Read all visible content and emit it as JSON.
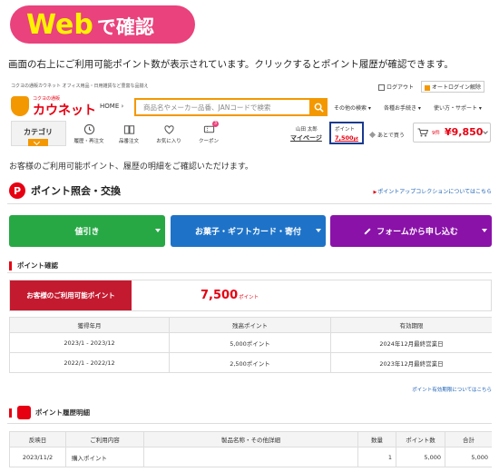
{
  "badge": {
    "web": "Web",
    "suffix": "で確認"
  },
  "caption": "画面の右上にご利用可能ポイント数が表示されています。クリックするとポイント履歴が確認できます。",
  "site": {
    "tagline": "コクヨの通販カウネット オフィス用品・日用雑貨など豊富な品揃え",
    "logo_small": "コクヨの通販",
    "logo_main": "カウネット",
    "logout": "ログアウト",
    "autologin": "オートログイン解除",
    "home": "HOME ›",
    "search_placeholder": "商品名やメーカー品番、JANコードで検索",
    "nav": [
      "その他の検索",
      "各種お手続き",
      "使い方・サポート"
    ],
    "category": "カテゴリ",
    "icons": [
      {
        "label": "履歴・再注文",
        "icon": "history-icon"
      },
      {
        "label": "品番注文",
        "icon": "book-icon"
      },
      {
        "label": "お気に入り",
        "icon": "heart-icon"
      },
      {
        "label": "クーポン",
        "icon": "coupon-icon",
        "count": "3"
      }
    ],
    "user_name": "山田 太郎",
    "mypage": "マイページ",
    "points_label": "ポイント",
    "points_value": "7,500",
    "points_unit": "pt",
    "later_buy": "あとで買う",
    "cart_count": "9件",
    "cart_total": "¥9,850"
  },
  "intro": "お客様のご利用可能ポイント、履歴の明細をご確認いただけます。",
  "section": {
    "p_glyph": "P",
    "title": "ポイント照会・交換",
    "link": "ポイントアップコレクションについてはこちら"
  },
  "buttons": {
    "discount": "値引き",
    "gift": "お菓子・ギフトカード・寄付",
    "form": "フォームから申し込む"
  },
  "point_check": {
    "title": "ポイント確認",
    "avail_label": "お客様のご利用可能ポイント",
    "avail_value": "7,500",
    "avail_unit": "ポイント",
    "headers": [
      "獲得年月",
      "残高ポイント",
      "有効期限"
    ],
    "rows": [
      [
        "2023/1 - 2023/12",
        "5,000ポイント",
        "2024年12月最終営業日"
      ],
      [
        "2022/1 - 2022/12",
        "2,500ポイント",
        "2023年12月最終営業日"
      ]
    ],
    "validity_link": "ポイント有効期限についてはこちら"
  },
  "history": {
    "title": "ポイント履歴明細",
    "headers": [
      "反映日",
      "ご利用内容",
      "製品名称・その他詳細",
      "数量",
      "ポイント数",
      "合計"
    ],
    "rows": [
      [
        "2023/11/2",
        "購入ポイント",
        "",
        "1",
        "5,000",
        "5,000"
      ]
    ]
  },
  "colors": {
    "badge": "#e9427c",
    "badge_text": "#fff200",
    "brand_orange": "#f39800",
    "brand_red": "#e60012",
    "green": "#27a845",
    "blue": "#1e73c8",
    "purple": "#8a12a8",
    "highlight": "#1a3a8f"
  }
}
